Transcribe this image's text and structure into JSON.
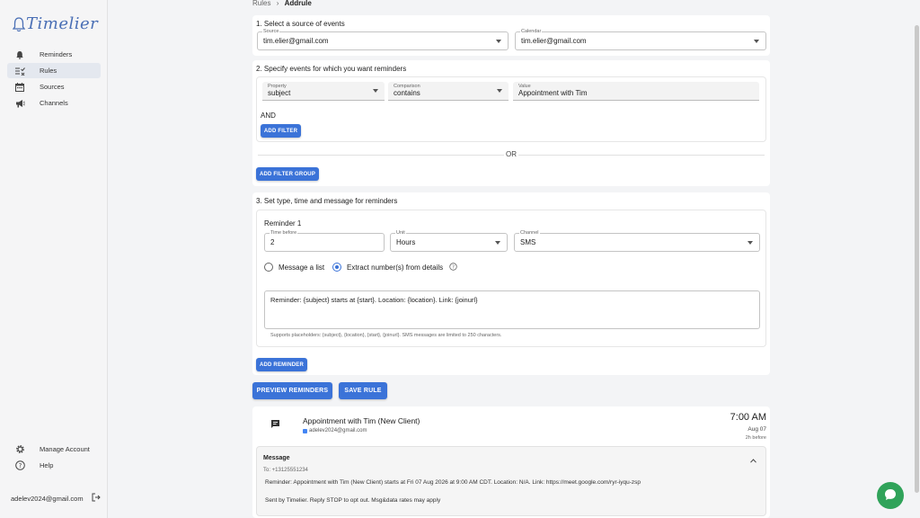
{
  "app": {
    "name": "Timelier"
  },
  "breadcrumb": {
    "parent": "Rules",
    "sep": "›",
    "current": "Addrule"
  },
  "sidebar": {
    "items": [
      {
        "label": "Reminders"
      },
      {
        "label": "Rules"
      },
      {
        "label": "Sources"
      },
      {
        "label": "Channels"
      }
    ],
    "bottom": [
      {
        "label": "Manage Account"
      },
      {
        "label": "Help"
      }
    ],
    "user_email": "adelev2024@gmail.com"
  },
  "step1": {
    "title": "1. Select a source of events",
    "source": {
      "label": "Source",
      "value": "tim.elier@gmail.com"
    },
    "calendar": {
      "label": "Calendar",
      "value": "tim.elier@gmail.com"
    }
  },
  "step2": {
    "title": "2. Specify events for which you want reminders",
    "property": {
      "label": "Property",
      "value": "subject"
    },
    "comparison": {
      "label": "Comparison",
      "value": "contains"
    },
    "value": {
      "label": "Value",
      "value": "Appointment with Tim"
    },
    "and_label": "AND",
    "add_filter": "ADD FILTER",
    "or_label": "OR",
    "add_filter_group": "ADD FILTER GROUP"
  },
  "step3": {
    "title": "3. Set type, time and message for reminders",
    "reminder_title": "Reminder 1",
    "time_before": {
      "label": "Time before",
      "value": "2"
    },
    "unit": {
      "label": "Unit",
      "value": "Hours"
    },
    "channel": {
      "label": "Channel",
      "value": "SMS"
    },
    "radio_list": "Message a list",
    "radio_extract": "Extract number(s) from details",
    "message": "Reminder: {subject} starts at {start}. Location: {location}. Link: {joinurl}",
    "hint": "Supports placeholders: {subject}, {location}, {start}, {joinurl}. SMS messages are limited to 250 characters.",
    "add_reminder": "ADD REMINDER"
  },
  "actions": {
    "preview": "PREVIEW REMINDERS",
    "save": "SAVE RULE"
  },
  "preview": {
    "title": "Appointment with Tim (New Client)",
    "email": "adelev2024@gmail.com",
    "time": "7:00 AM",
    "date": "Aug 07",
    "before": "2h before",
    "message_header": "Message",
    "to": "To: +13125551234",
    "body": "Reminder: Appointment with Tim (New Client) starts at Fri 07 Aug 2026 at 9:00 AM CDT. Location: N/A. Link: https://meet.google.com/ryr-iyqu-zsp",
    "footer": "Sent by Timelier. Reply STOP to opt out. Msg&data rates may apply"
  },
  "colors": {
    "accent": "#3b73d8",
    "chat": "#30a35a",
    "brand": "#4a6fb5"
  }
}
